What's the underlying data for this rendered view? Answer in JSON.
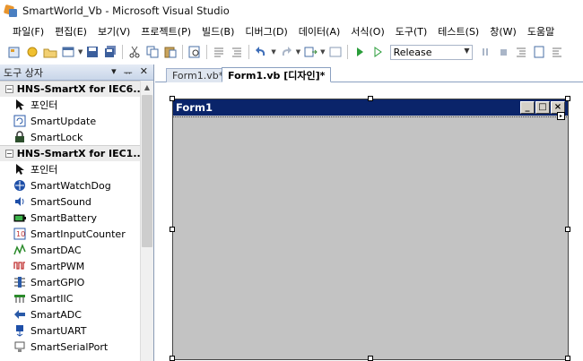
{
  "window": {
    "title": "SmartWorld_Vb - Microsoft Visual Studio"
  },
  "menu": [
    "파일(F)",
    "편집(E)",
    "보기(V)",
    "프로젝트(P)",
    "빌드(B)",
    "디버그(D)",
    "데이터(A)",
    "서식(O)",
    "도구(T)",
    "테스트(S)",
    "창(W)",
    "도움말"
  ],
  "toolbar": {
    "configuration": "Release"
  },
  "toolbox": {
    "title": "도구 상자",
    "pin_glyph": "ᅲ",
    "close_glyph": "✕",
    "dropdown_glyph": "▾",
    "groups": [
      {
        "name": "HNS-SmartX for IEC6...",
        "items": [
          {
            "label": "포인터",
            "icon": "pointer-icon"
          },
          {
            "label": "SmartUpdate",
            "icon": "update-icon"
          },
          {
            "label": "SmartLock",
            "icon": "lock-icon"
          }
        ]
      },
      {
        "name": "HNS-SmartX for IEC1...",
        "items": [
          {
            "label": "포인터",
            "icon": "pointer-icon"
          },
          {
            "label": "SmartWatchDog",
            "icon": "watchdog-icon"
          },
          {
            "label": "SmartSound",
            "icon": "sound-icon"
          },
          {
            "label": "SmartBattery",
            "icon": "battery-icon"
          },
          {
            "label": "SmartInputCounter",
            "icon": "counter-icon"
          },
          {
            "label": "SmartDAC",
            "icon": "dac-icon"
          },
          {
            "label": "SmartPWM",
            "icon": "pwm-icon"
          },
          {
            "label": "SmartGPIO",
            "icon": "gpio-icon"
          },
          {
            "label": "SmartIIC",
            "icon": "iic-icon"
          },
          {
            "label": "SmartADC",
            "icon": "adc-icon"
          },
          {
            "label": "SmartUART",
            "icon": "uart-icon"
          },
          {
            "label": "SmartSerialPort",
            "icon": "serialport-icon"
          }
        ]
      }
    ]
  },
  "tabs": [
    {
      "label": "Form1.vb*",
      "active": false
    },
    {
      "label": "Form1.vb [디자인]*",
      "active": true
    }
  ],
  "designer": {
    "form_title": "Form1",
    "minimize_glyph": "_",
    "maximize_glyph": "□",
    "close_glyph": "×"
  }
}
